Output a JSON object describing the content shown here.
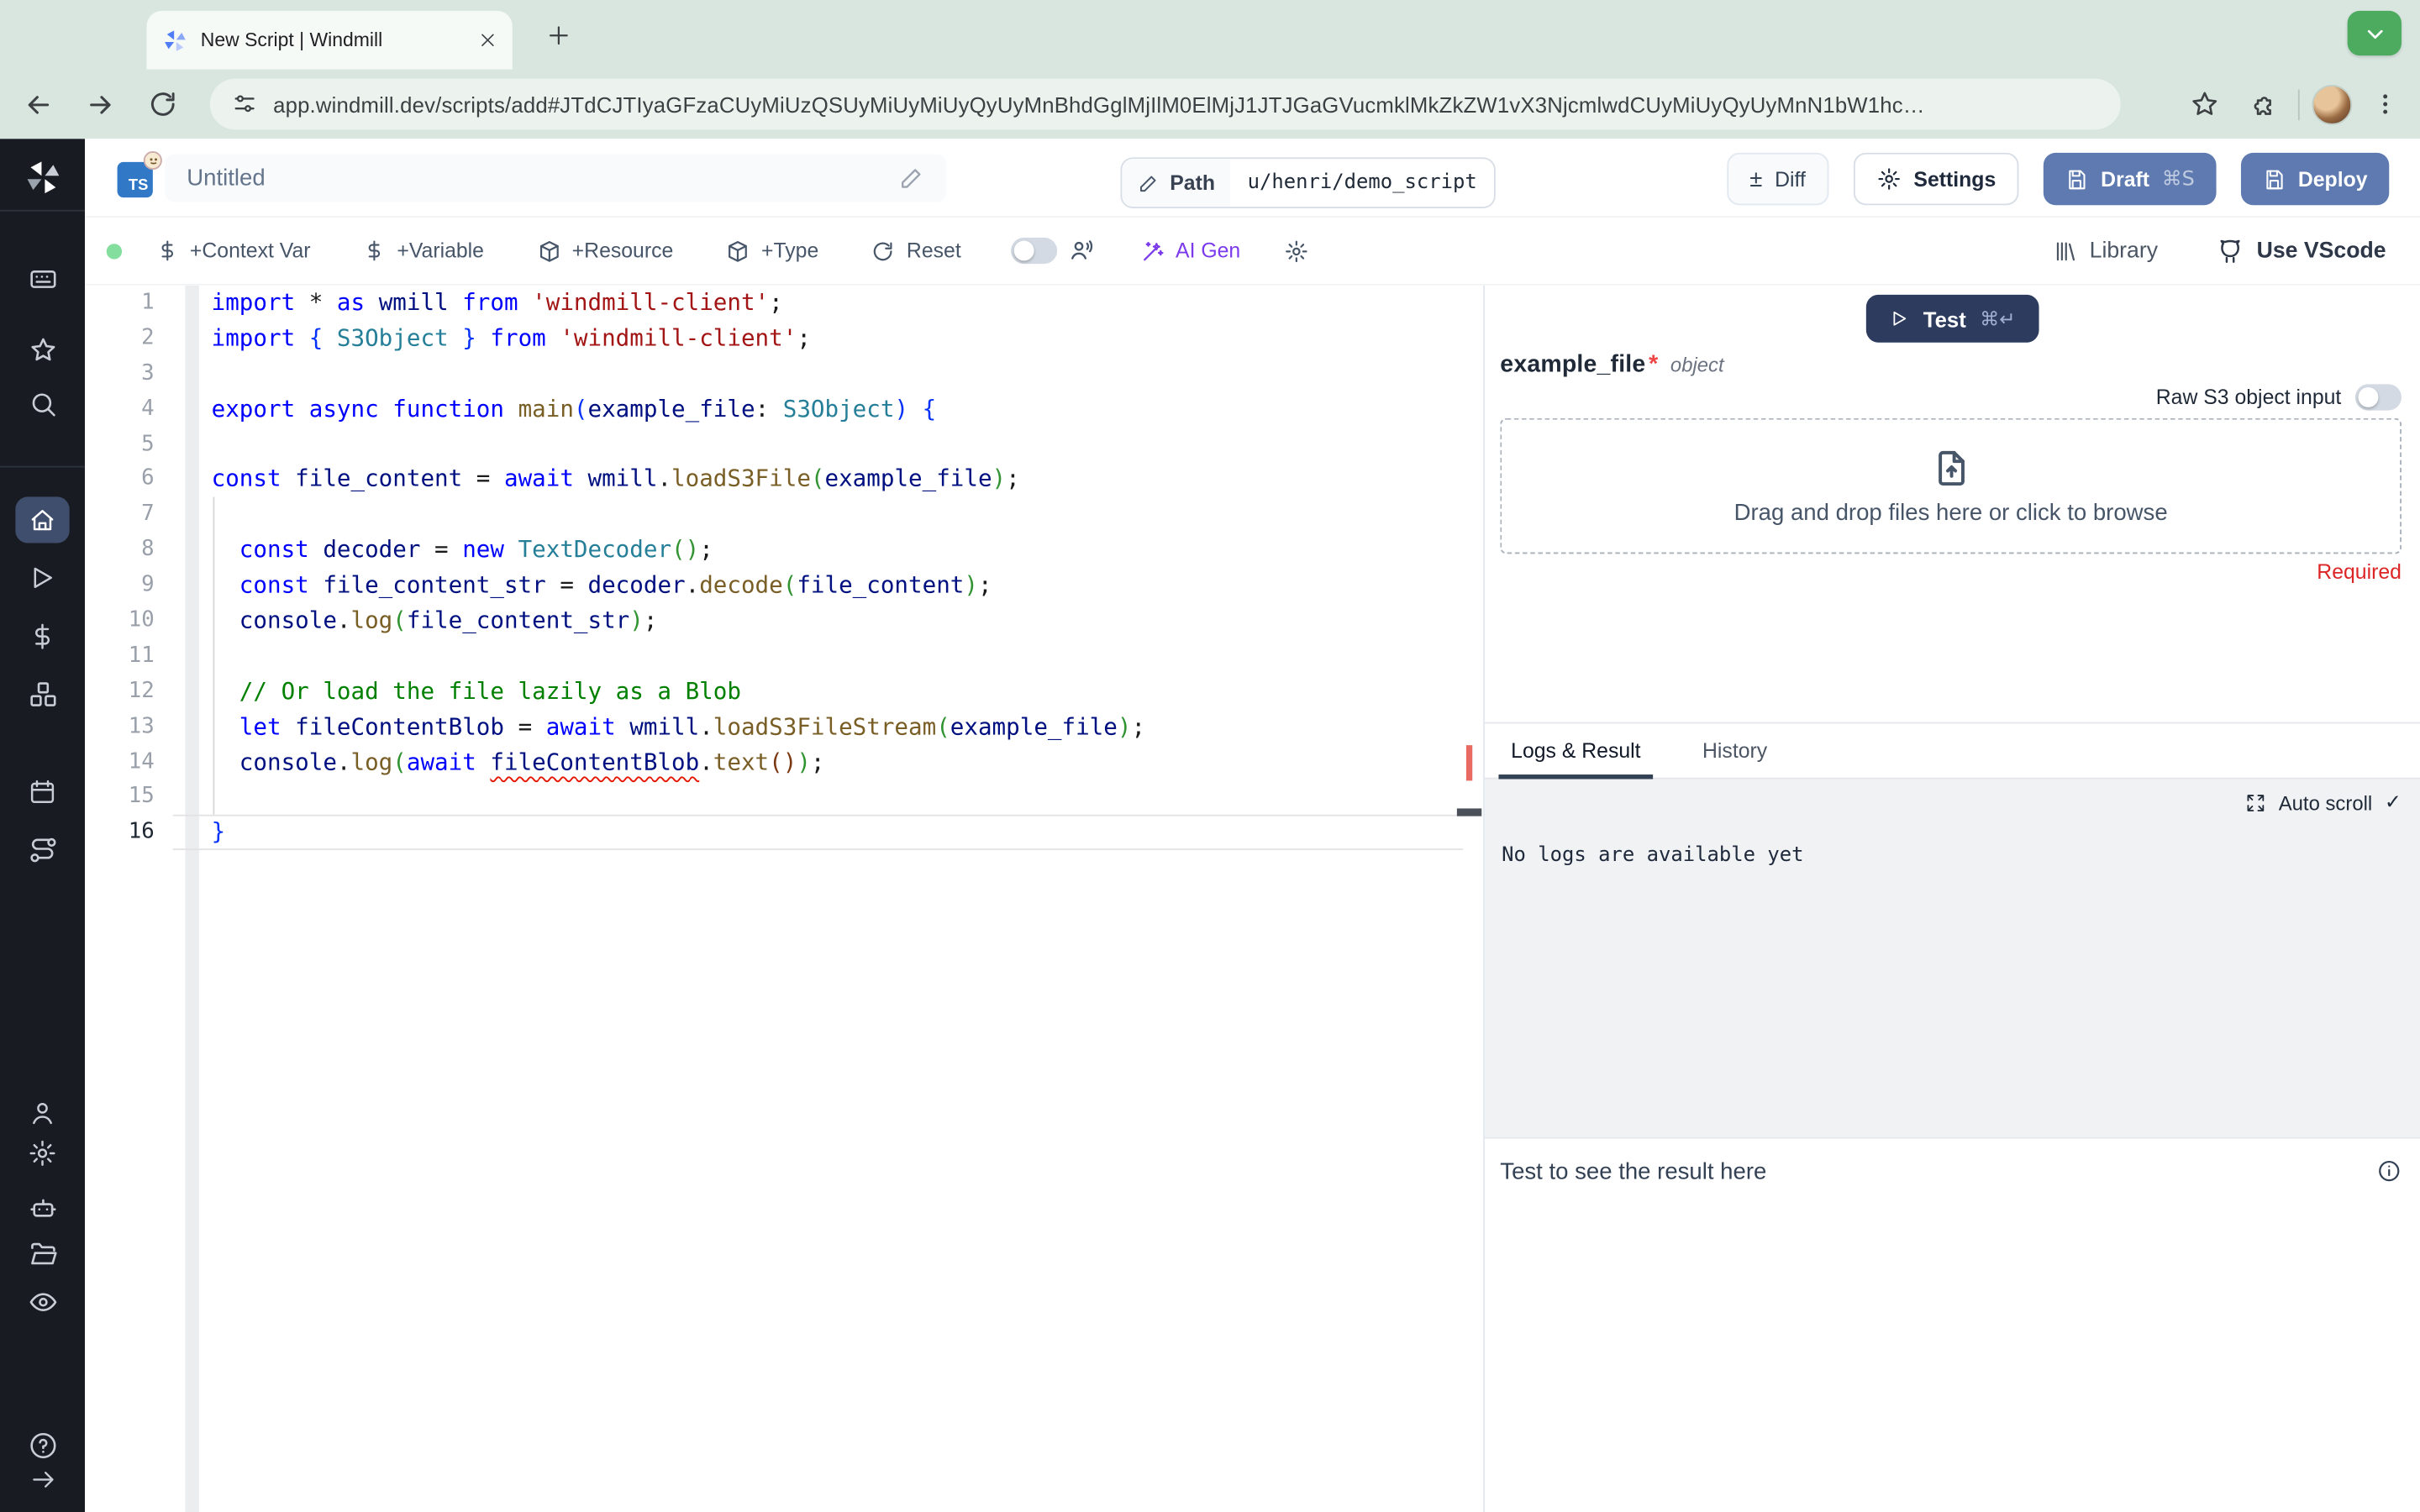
{
  "browser": {
    "tab_title": "New Script | Windmill",
    "url": "app.windmill.dev/scripts/add#JTdCJTIyaGFzaCUyMiUzQSUyMiUyMiUyQyUyMnBhdGglMjIlM0ElMjJ1JTJGaGVucmklMkZkZW1vX3NjcmlwdCUyMiUyQyUyMnN1bW1hc…"
  },
  "header": {
    "script_title": "Untitled",
    "path_label": "Path",
    "path_value": "u/henri/demo_script",
    "plusminus": "±",
    "diff_label": "Diff",
    "settings_label": "Settings",
    "draft_label": "Draft",
    "draft_shortcut": "⌘S",
    "deploy_label": "Deploy"
  },
  "toolbar": {
    "context_var": "+Context Var",
    "variable": "+Variable",
    "resource": "+Resource",
    "type": "+Type",
    "reset": "Reset",
    "ai_gen": "AI Gen",
    "library": "Library",
    "use_vscode": "Use VScode"
  },
  "editor": {
    "language": "typescript",
    "current_line": 16,
    "lines": [
      [
        [
          "kw",
          "import"
        ],
        [
          "pl",
          " * "
        ],
        [
          "kw",
          "as"
        ],
        [
          "pl",
          " "
        ],
        [
          "var",
          "wmill"
        ],
        [
          "pl",
          " "
        ],
        [
          "kw",
          "from"
        ],
        [
          "pl",
          " "
        ],
        [
          "str",
          "'windmill-client'"
        ],
        [
          "pl",
          ";"
        ]
      ],
      [
        [
          "kw",
          "import"
        ],
        [
          "pl",
          " "
        ],
        [
          "b1",
          "{"
        ],
        [
          "pl",
          " "
        ],
        [
          "type",
          "S3Object"
        ],
        [
          "pl",
          " "
        ],
        [
          "b1",
          "}"
        ],
        [
          "pl",
          " "
        ],
        [
          "kw",
          "from"
        ],
        [
          "pl",
          " "
        ],
        [
          "str",
          "'windmill-client'"
        ],
        [
          "pl",
          ";"
        ]
      ],
      [],
      [
        [
          "kw",
          "export"
        ],
        [
          "pl",
          " "
        ],
        [
          "kw",
          "async"
        ],
        [
          "pl",
          " "
        ],
        [
          "kw",
          "function"
        ],
        [
          "pl",
          " "
        ],
        [
          "fn",
          "main"
        ],
        [
          "b1",
          "("
        ],
        [
          "var",
          "example_file"
        ],
        [
          "pl",
          ": "
        ],
        [
          "type",
          "S3Object"
        ],
        [
          "b1",
          ")"
        ],
        [
          "pl",
          " "
        ],
        [
          "b1",
          "{"
        ]
      ],
      [],
      [
        [
          "kw",
          "const"
        ],
        [
          "pl",
          " "
        ],
        [
          "var",
          "file_content"
        ],
        [
          "pl",
          " = "
        ],
        [
          "kw",
          "await"
        ],
        [
          "pl",
          " "
        ],
        [
          "var",
          "wmill"
        ],
        [
          "pl",
          "."
        ],
        [
          "fn",
          "loadS3File"
        ],
        [
          "b2",
          "("
        ],
        [
          "var",
          "example_file"
        ],
        [
          "b2",
          ")"
        ],
        [
          "pl",
          ";"
        ]
      ],
      [],
      [
        [
          "pl",
          "  "
        ],
        [
          "kw",
          "const"
        ],
        [
          "pl",
          " "
        ],
        [
          "var",
          "decoder"
        ],
        [
          "pl",
          " = "
        ],
        [
          "kw",
          "new"
        ],
        [
          "pl",
          " "
        ],
        [
          "type",
          "TextDecoder"
        ],
        [
          "b2",
          "()"
        ],
        [
          "pl",
          ";"
        ]
      ],
      [
        [
          "pl",
          "  "
        ],
        [
          "kw",
          "const"
        ],
        [
          "pl",
          " "
        ],
        [
          "var",
          "file_content_str"
        ],
        [
          "pl",
          " = "
        ],
        [
          "var",
          "decoder"
        ],
        [
          "pl",
          "."
        ],
        [
          "fn",
          "decode"
        ],
        [
          "b2",
          "("
        ],
        [
          "var",
          "file_content"
        ],
        [
          "b2",
          ")"
        ],
        [
          "pl",
          ";"
        ]
      ],
      [
        [
          "pl",
          "  "
        ],
        [
          "var",
          "console"
        ],
        [
          "pl",
          "."
        ],
        [
          "fn",
          "log"
        ],
        [
          "b2",
          "("
        ],
        [
          "var",
          "file_content_str"
        ],
        [
          "b2",
          ")"
        ],
        [
          "pl",
          ";"
        ]
      ],
      [],
      [
        [
          "pl",
          "  "
        ],
        [
          "cmt",
          "// Or load the file lazily as a Blob"
        ]
      ],
      [
        [
          "pl",
          "  "
        ],
        [
          "kw",
          "let"
        ],
        [
          "pl",
          " "
        ],
        [
          "var",
          "fileContentBlob"
        ],
        [
          "pl",
          " = "
        ],
        [
          "kw",
          "await"
        ],
        [
          "pl",
          " "
        ],
        [
          "var",
          "wmill"
        ],
        [
          "pl",
          "."
        ],
        [
          "fn",
          "loadS3FileStream"
        ],
        [
          "b2",
          "("
        ],
        [
          "var",
          "example_file"
        ],
        [
          "b2",
          ")"
        ],
        [
          "pl",
          ";"
        ]
      ],
      [
        [
          "pl",
          "  "
        ],
        [
          "var",
          "console"
        ],
        [
          "pl",
          "."
        ],
        [
          "fn",
          "log"
        ],
        [
          "b2",
          "("
        ],
        [
          "kw",
          "await"
        ],
        [
          "pl",
          " "
        ],
        [
          "sq",
          "fileContentBlob"
        ],
        [
          "pl",
          "."
        ],
        [
          "fn",
          "text"
        ],
        [
          "b3",
          "()"
        ],
        [
          "b2",
          ")"
        ],
        [
          "pl",
          ";"
        ]
      ],
      [],
      [
        [
          "b1",
          "}"
        ]
      ]
    ]
  },
  "right": {
    "test_label": "Test",
    "test_shortcut": "⌘↵",
    "arg_name": "example_file",
    "required_star": "*",
    "arg_type": "object",
    "raw_s3_label": "Raw S3 object input",
    "dropzone_text": "Drag and drop files here or click to browse",
    "required_label": "Required",
    "tab_logs": "Logs & Result",
    "tab_history": "History",
    "auto_scroll": "Auto scroll",
    "check": "✓",
    "no_logs": "No logs are available yet",
    "result_placeholder": "Test to see the result here"
  },
  "sidebar": {
    "top_icons": [
      "windmill-logo",
      "keyboard",
      "star",
      "search",
      "home",
      "play",
      "dollar",
      "cubes",
      "calendar",
      "route"
    ],
    "bottom_icons": [
      "user",
      "gear",
      "robot",
      "folder",
      "eye",
      "help",
      "arrow-right"
    ],
    "active_item": "home"
  },
  "colors": {
    "chrome_bg": "#d9e6e0",
    "sidebar_bg": "#181c22",
    "sidebar_active": "#3f4e6d",
    "primary_button": "#5e7ab0",
    "test_button": "#2c3b5e",
    "ai_gen": "#7c3aed",
    "required_red": "#dc2626",
    "error_red": "#e51400",
    "live_dot_green": "#84de9d",
    "profile_green": "#4cab5f"
  }
}
